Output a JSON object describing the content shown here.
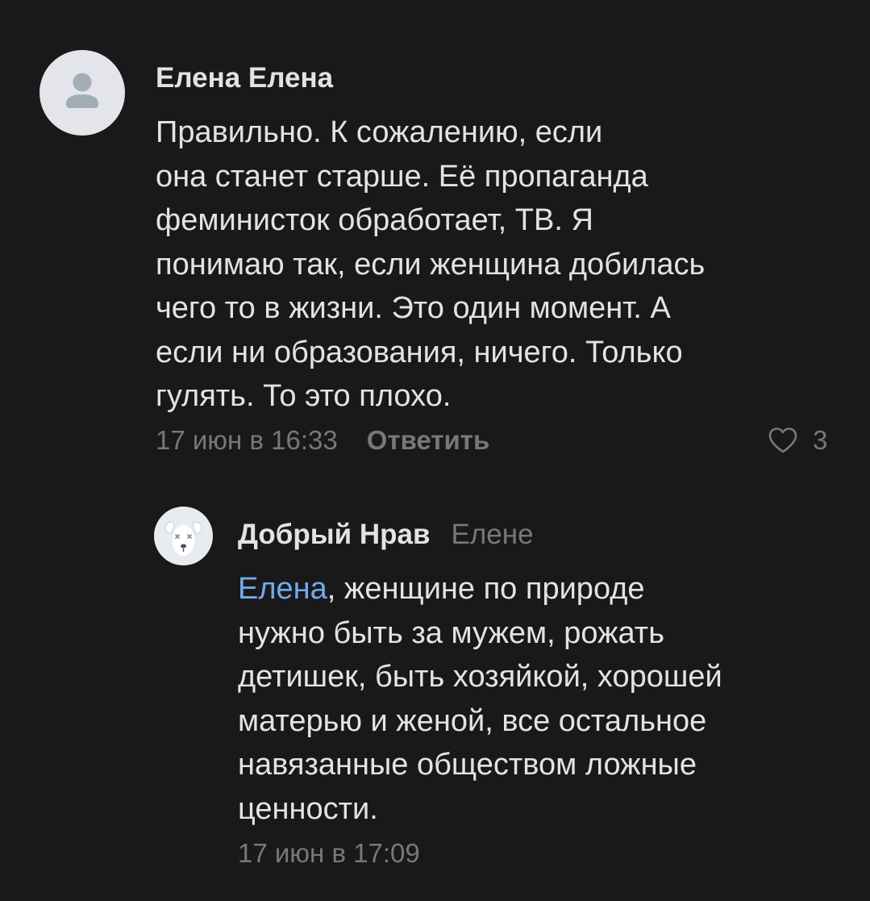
{
  "comments": [
    {
      "author": "Елена Елена",
      "text_lines": [
        "Правильно. К сожалению, если",
        "она станет старше. Её пропаганда",
        "феминисток обработает, ТВ. Я",
        "понимаю так, если женщина добилась",
        "чего то в жизни. Это один момент. А",
        "если ни образования, ничего. Только",
        "гулять. То это плохо."
      ],
      "date": "17 июн в 16:33",
      "reply_label": "Ответить",
      "likes": "3",
      "avatar_icon": "user-placeholder-icon"
    },
    {
      "author": "Добрый Нрав",
      "reply_to": "Елене",
      "mention": "Елена",
      "text_first_line_rest": ", женщине по природе",
      "text_lines": [
        "нужно быть за мужем, рожать",
        "детишек, быть хозяйкой, хорошей",
        "матерью и женой, все остальное",
        "навязанные обществом ложные",
        "ценности."
      ],
      "date": "17 июн в 17:09",
      "avatar_icon": "deactivated-dog-icon"
    }
  ],
  "colors": {
    "background": "#19191a",
    "text": "#e1e3e6",
    "secondary": "#76787a",
    "link": "#71aaeb"
  }
}
